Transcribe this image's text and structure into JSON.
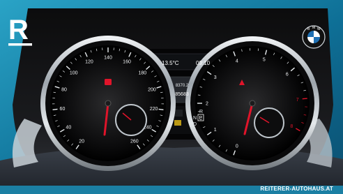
{
  "brand": {
    "logo_letter": "R",
    "website": "REITERER-AUTOHAUS.AT",
    "badge_letters": [
      "B",
      "M",
      "W"
    ]
  },
  "cluster": {
    "temperature": "13.5°C",
    "clock": "09:10",
    "trip_km": "8370.2",
    "odometer_km": "85683",
    "gear_letters": [
      "R",
      "N",
      "P",
      "D"
    ],
    "selected_gear": "P",
    "speedometer": {
      "ticks": [
        "20",
        "40",
        "60",
        "80",
        "100",
        "120",
        "140",
        "160",
        "180",
        "200",
        "220",
        "240",
        "260"
      ],
      "unit": "km/h"
    },
    "tachometer": {
      "ticks": [
        "0",
        "1",
        "2",
        "3",
        "4",
        "5",
        "6",
        "7",
        "8"
      ],
      "unit": "x1000/min"
    }
  },
  "colors": {
    "background_teal": "#1e8fb5",
    "needle_red": "#e0142a",
    "footer_bar": "#1b7fa3"
  }
}
